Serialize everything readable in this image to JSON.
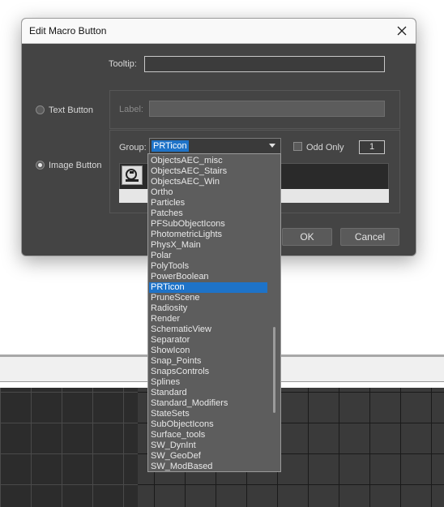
{
  "dialog": {
    "title": "Edit Macro Button",
    "tooltip_label": "Tooltip:",
    "tooltip_value": "",
    "text_button_label": "Text Button",
    "label_label": "Label:",
    "label_value": "",
    "image_button_label": "Image Button",
    "group_label": "Group:",
    "group_selected": "PRTicon",
    "odd_only_label": "Odd Only",
    "odd_only_checked": false,
    "index_value": "1",
    "ok_label": "OK",
    "cancel_label": "Cancel",
    "selected_radio": "image-button"
  },
  "dropdown": {
    "items": [
      "ObjectsAEC_misc",
      "ObjectsAEC_Stairs",
      "ObjectsAEC_Win",
      "Ortho",
      "Particles",
      "Patches",
      "PFSubObjectIcons",
      "PhotometricLights",
      "PhysX_Main",
      "Polar",
      "PolyTools",
      "PowerBoolean",
      "PRTicon",
      "PruneScene",
      "Radiosity",
      "Render",
      "SchematicView",
      "Separator",
      "ShowIcon",
      "Snap_Points",
      "SnapsControls",
      "Splines",
      "Standard",
      "Standard_Modifiers",
      "StateSets",
      "SubObjectIcons",
      "Surface_tools",
      "SW_DynInt",
      "SW_GeoDef",
      "SW_ModBased"
    ],
    "selected": "PRTicon"
  },
  "colors": {
    "dialog_bg": "#444444",
    "selection": "#1e73c8"
  }
}
